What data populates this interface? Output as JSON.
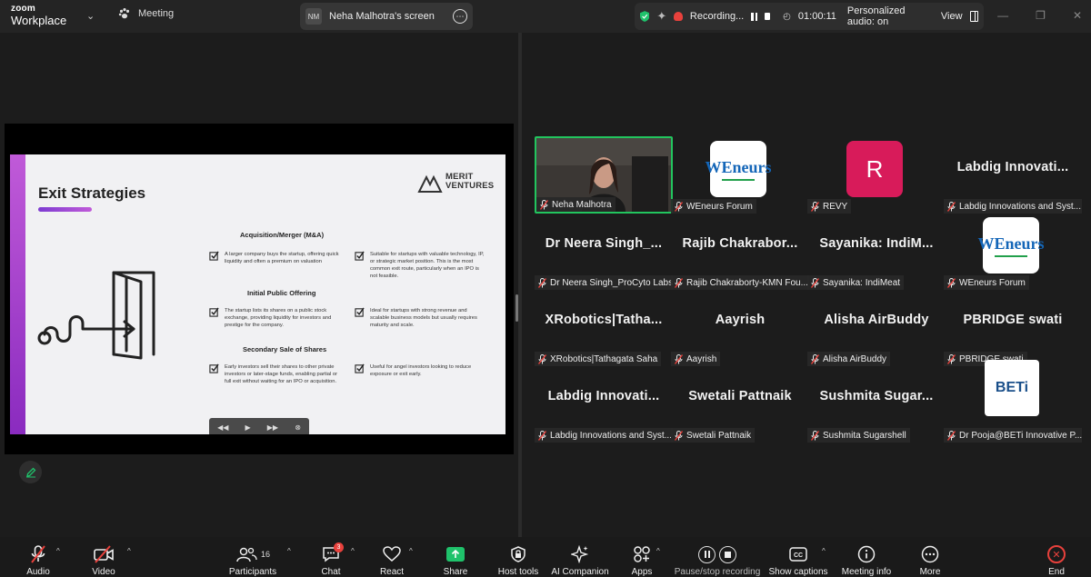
{
  "app": {
    "logo_line1": "zoom",
    "logo_line2": "Workplace",
    "meeting_label": "Meeting",
    "screen_tab": {
      "initials": "NM",
      "title": "Neha Malhotra's screen"
    },
    "recording": {
      "label": "Recording...",
      "timer": "01:00:11",
      "audio": "Personalized audio: on",
      "view": "View"
    }
  },
  "slide": {
    "title": "Exit Strategies",
    "brand_line1": "MERIT",
    "brand_line2": "VENTURES",
    "sections": [
      {
        "heading": "Acquisition/Merger (M&A)",
        "left": "A larger company buys the startup, offering quick liquidity and often a premium on valuation",
        "right": "Suitable for startups with valuable technology, IP, or strategic market position. This is the most common exit route, particularly when an IPO is not feasible."
      },
      {
        "heading": "Initial Public Offering",
        "left": "The startup lists its shares on a public stock exchange, providing liquidity for investors and prestige for the company.",
        "right": "Ideal for startups with strong revenue and scalable business models but usually requires maturity and scale."
      },
      {
        "heading": "Secondary Sale of Shares",
        "left": "Early investors sell their shares to other private investors or later-stage funds, enabling partial or full exit without waiting for an IPO or acquisition.",
        "right": "Useful for angel investors looking to reduce exposure or exit early."
      }
    ]
  },
  "participants": [
    {
      "display": "",
      "name": "Neha Malhotra",
      "type": "video"
    },
    {
      "display": "WEneurs",
      "name": "WEneurs Forum",
      "type": "logo-we"
    },
    {
      "display": "R",
      "name": "REVY",
      "type": "avatar"
    },
    {
      "display": "Labdig  Innovati...",
      "name": "Labdig Innovations and Syst...",
      "type": "text"
    },
    {
      "display": "Dr Neera Singh_...",
      "name": "Dr Neera Singh_ProCyto Labs",
      "type": "text"
    },
    {
      "display": "Rajib  Chakrabor...",
      "name": "Rajib Chakraborty-KMN Fou...",
      "type": "text"
    },
    {
      "display": "Sayanika:  IndiM...",
      "name": "Sayanika: IndiMeat",
      "type": "text"
    },
    {
      "display": "WEneurs",
      "name": "WEneurs Forum",
      "type": "logo-we"
    },
    {
      "display": "XRobotics|Tatha...",
      "name": "XRobotics|Tathagata Saha",
      "type": "text"
    },
    {
      "display": "Aayrish",
      "name": "Aayrish",
      "type": "text"
    },
    {
      "display": "Alisha  AirBuddy",
      "name": "Alisha AirBuddy",
      "type": "text"
    },
    {
      "display": "PBRIDGE  swati",
      "name": "PBRIDGE swati",
      "type": "text"
    },
    {
      "display": "Labdig  Innovati...",
      "name": "Labdig Innovations and Syst...",
      "type": "text"
    },
    {
      "display": "Swetali  Pattnaik",
      "name": "Swetali Pattnaik",
      "type": "text"
    },
    {
      "display": "Sushmita  Sugar...",
      "name": "Sushmita Sugarshell",
      "type": "text"
    },
    {
      "display": "BETi",
      "name": "Dr Pooja@BETi Innovative P...",
      "type": "logo-beti"
    }
  ],
  "toolbar": {
    "audio": "Audio",
    "video": "Video",
    "participants": "Participants",
    "participants_count": "16",
    "chat": "Chat",
    "chat_badge": "3",
    "react": "React",
    "share": "Share",
    "host_tools": "Host tools",
    "ai": "AI Companion",
    "apps": "Apps",
    "recording": "Pause/stop recording",
    "captions": "Show captions",
    "meeting_info": "Meeting info",
    "more": "More",
    "end": "End"
  },
  "colors": {
    "accent_green": "#22c55e",
    "share_green": "#1fc26b",
    "record_red": "#e8413c",
    "slide_purple": "#8a2bbf",
    "revy": "#d81b5a"
  }
}
